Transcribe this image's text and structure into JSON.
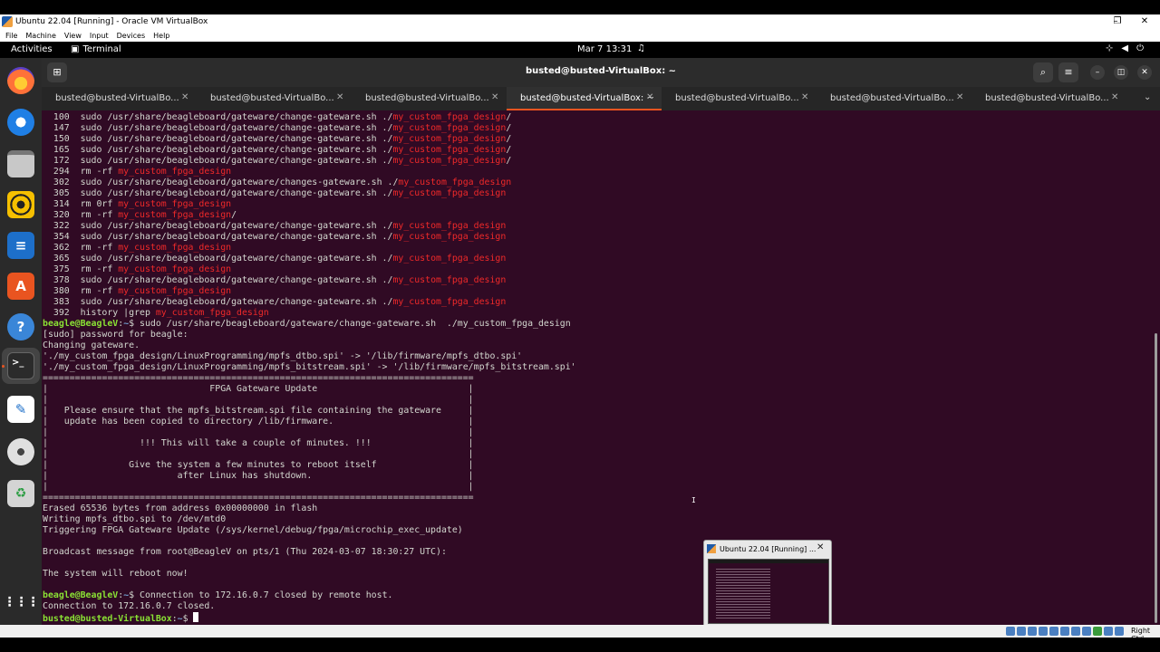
{
  "vbox": {
    "title": "Ubuntu 22.04 [Running] - Oracle VM VirtualBox",
    "menu": [
      "File",
      "Machine",
      "View",
      "Input",
      "Devices",
      "Help"
    ],
    "host_key": "Right Ctrl"
  },
  "topbar": {
    "activities": "Activities",
    "app": "Terminal",
    "clock": "Mar 7  13:31"
  },
  "dock": {
    "items": [
      "firefox-icon",
      "thunderbird-icon",
      "files-icon",
      "rhythmbox-icon",
      "writer-icon",
      "app-center-icon",
      "help-icon",
      "terminal-icon",
      "text-editor-icon",
      "dvd-icon",
      "trash-icon",
      "show-apps-icon"
    ],
    "active": "terminal-icon"
  },
  "terminal": {
    "title": "busted@busted-VirtualBox: ~",
    "tabs": [
      {
        "label": "busted@busted-VirtualBo..."
      },
      {
        "label": "busted@busted-VirtualBo..."
      },
      {
        "label": "busted@busted-VirtualBo..."
      },
      {
        "label": "busted@busted-VirtualBox: ~"
      },
      {
        "label": "busted@busted-VirtualBo..."
      },
      {
        "label": "busted@busted-VirtualBo..."
      },
      {
        "label": "busted@busted-VirtualBo..."
      }
    ],
    "active_tab": 3,
    "lines": [
      [
        {
          "t": "  100  sudo /usr/share/beagleboard/gateware/change-gateware.sh ./"
        },
        {
          "t": "my_custom_fpga_design",
          "c": "red"
        },
        {
          "t": "/"
        }
      ],
      [
        {
          "t": "  147  sudo /usr/share/beagleboard/gateware/change-gateware.sh ./"
        },
        {
          "t": "my_custom_fpga_design",
          "c": "red"
        },
        {
          "t": "/"
        }
      ],
      [
        {
          "t": "  150  sudo /usr/share/beagleboard/gateware/change-gateware.sh ./"
        },
        {
          "t": "my_custom_fpga_design",
          "c": "red"
        },
        {
          "t": "/"
        }
      ],
      [
        {
          "t": "  165  sudo /usr/share/beagleboard/gateware/change-gateware.sh ./"
        },
        {
          "t": "my_custom_fpga_design",
          "c": "red"
        },
        {
          "t": "/"
        }
      ],
      [
        {
          "t": "  172  sudo /usr/share/beagleboard/gateware/change-gateware.sh ./"
        },
        {
          "t": "my_custom_fpga_design",
          "c": "red"
        },
        {
          "t": "/"
        }
      ],
      [
        {
          "t": "  294  rm -rf "
        },
        {
          "t": "my_custom_fpga_design",
          "c": "red"
        }
      ],
      [
        {
          "t": "  302  sudo /usr/share/beagleboard/gateware/changes-gateware.sh ./"
        },
        {
          "t": "my_custom_fpga_design",
          "c": "red"
        }
      ],
      [
        {
          "t": "  305  sudo /usr/share/beagleboard/gateware/change-gateware.sh ./"
        },
        {
          "t": "my_custom_fpga_design",
          "c": "red"
        }
      ],
      [
        {
          "t": "  314  rm 0rf "
        },
        {
          "t": "my_custom_fpga_design",
          "c": "red"
        }
      ],
      [
        {
          "t": "  320  rm -rf "
        },
        {
          "t": "my_custom_fpga_design",
          "c": "red"
        },
        {
          "t": "/"
        }
      ],
      [
        {
          "t": "  322  sudo /usr/share/beagleboard/gateware/change-gateware.sh ./"
        },
        {
          "t": "my_custom_fpga_design",
          "c": "red"
        }
      ],
      [
        {
          "t": "  354  sudo /usr/share/beagleboard/gateware/change-gateware.sh ./"
        },
        {
          "t": "my_custom_fpga_design",
          "c": "red"
        }
      ],
      [
        {
          "t": "  362  rm -rf "
        },
        {
          "t": "my_custom_fpga_design",
          "c": "red"
        }
      ],
      [
        {
          "t": "  365  sudo /usr/share/beagleboard/gateware/change-gateware.sh ./"
        },
        {
          "t": "my_custom_fpga_design",
          "c": "red"
        }
      ],
      [
        {
          "t": "  375  rm -rf "
        },
        {
          "t": "my_custom_fpga_design",
          "c": "red"
        }
      ],
      [
        {
          "t": "  378  sudo /usr/share/beagleboard/gateware/change-gateware.sh ./"
        },
        {
          "t": "my_custom_fpga_design",
          "c": "red"
        }
      ],
      [
        {
          "t": "  380  rm -rf "
        },
        {
          "t": "my_custom_fpga_design",
          "c": "red"
        }
      ],
      [
        {
          "t": "  383  sudo /usr/share/beagleboard/gateware/change-gateware.sh ./"
        },
        {
          "t": "my_custom_fpga_design",
          "c": "red"
        }
      ],
      [
        {
          "t": "  392  history |grep "
        },
        {
          "t": "my_custom_fpga_design",
          "c": "red"
        }
      ],
      [
        {
          "t": "beagle@BeagleV",
          "c": "green"
        },
        {
          "t": ":"
        },
        {
          "t": "~",
          "c": "blue"
        },
        {
          "t": "$ sudo /usr/share/beagleboard/gateware/change-gateware.sh  ./my_custom_fpga_design"
        }
      ],
      [
        {
          "t": "[sudo] password for beagle:"
        }
      ],
      [
        {
          "t": "Changing gateware."
        }
      ],
      [
        {
          "t": "'./my_custom_fpga_design/LinuxProgramming/mpfs_dtbo.spi' -> '/lib/firmware/mpfs_dtbo.spi'"
        }
      ],
      [
        {
          "t": "'./my_custom_fpga_design/LinuxProgramming/mpfs_bitstream.spi' -> '/lib/firmware/mpfs_bitstream.spi'"
        }
      ],
      [
        {
          "t": "================================================================================"
        }
      ],
      [
        {
          "t": "|                              FPGA Gateware Update                            |"
        }
      ],
      [
        {
          "t": "|                                                                              |"
        }
      ],
      [
        {
          "t": "|   Please ensure that the mpfs_bitstream.spi file containing the gateware     |"
        }
      ],
      [
        {
          "t": "|   update has been copied to directory /lib/firmware.                         |"
        }
      ],
      [
        {
          "t": "|                                                                              |"
        }
      ],
      [
        {
          "t": "|                 !!! This will take a couple of minutes. !!!                  |"
        }
      ],
      [
        {
          "t": "|                                                                              |"
        }
      ],
      [
        {
          "t": "|               Give the system a few minutes to reboot itself                 |"
        }
      ],
      [
        {
          "t": "|                        after Linux has shutdown.                             |"
        }
      ],
      [
        {
          "t": "|                                                                              |"
        }
      ],
      [
        {
          "t": "================================================================================"
        }
      ],
      [
        {
          "t": "Erased 65536 bytes from address 0x00000000 in flash"
        }
      ],
      [
        {
          "t": "Writing mpfs_dtbo.spi to /dev/mtd0"
        }
      ],
      [
        {
          "t": "Triggering FPGA Gateware Update (/sys/kernel/debug/fpga/microchip_exec_update)"
        }
      ],
      [
        {
          "t": ""
        }
      ],
      [
        {
          "t": "Broadcast message from root@BeagleV on pts/1 (Thu 2024-03-07 18:30:27 UTC):"
        }
      ],
      [
        {
          "t": ""
        }
      ],
      [
        {
          "t": "The system will reboot now!"
        }
      ],
      [
        {
          "t": ""
        }
      ],
      [
        {
          "t": "beagle@BeagleV",
          "c": "green"
        },
        {
          "t": ":"
        },
        {
          "t": "~",
          "c": "blue"
        },
        {
          "t": "$ Connection to 172.16.0.7 closed by remote host."
        }
      ],
      [
        {
          "t": "Connection to 172.16.0.7 closed."
        }
      ],
      [
        {
          "t": "busted@busted-VirtualBox",
          "c": "green"
        },
        {
          "t": ":"
        },
        {
          "t": "~",
          "c": "blue"
        },
        {
          "t": "$ "
        },
        {
          "t": "",
          "c": "cursor"
        }
      ]
    ]
  },
  "taskbar_preview": {
    "title": "Ubuntu 22.04 [Running] ..."
  }
}
